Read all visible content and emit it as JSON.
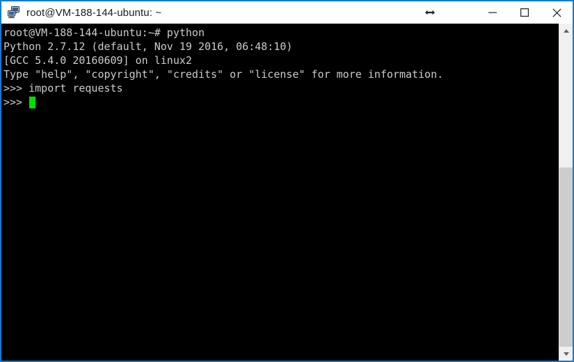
{
  "window": {
    "title": "root@VM-188-144-ubuntu: ~",
    "icon": "putty-terminal-icon",
    "border_color": "#0a7cd4",
    "titlebar_bg": "#ffffff",
    "titlebar_fg": "#1a1a1a"
  },
  "titlebar_controls": {
    "resize_label": "↔",
    "minimize_label": "—",
    "maximize_label": "□",
    "close_label": "✕"
  },
  "terminal": {
    "background": "#000000",
    "foreground": "#cccccc",
    "cursor_color": "#00e000",
    "lines": [
      "root@VM-188-144-ubuntu:~# python",
      "Python 2.7.12 (default, Nov 19 2016, 06:48:10)",
      "[GCC 5.4.0 20160609] on linux2",
      "Type \"help\", \"copyright\", \"credits\" or \"license\" for more information.",
      ">>> import requests"
    ],
    "prompt": ">>> ",
    "cursor": "█"
  },
  "scrollbar": {
    "up_arrow": "▲",
    "down_arrow": "▼",
    "track_color": "#f0f0f0",
    "thumb_color": "#cdcdcd"
  }
}
